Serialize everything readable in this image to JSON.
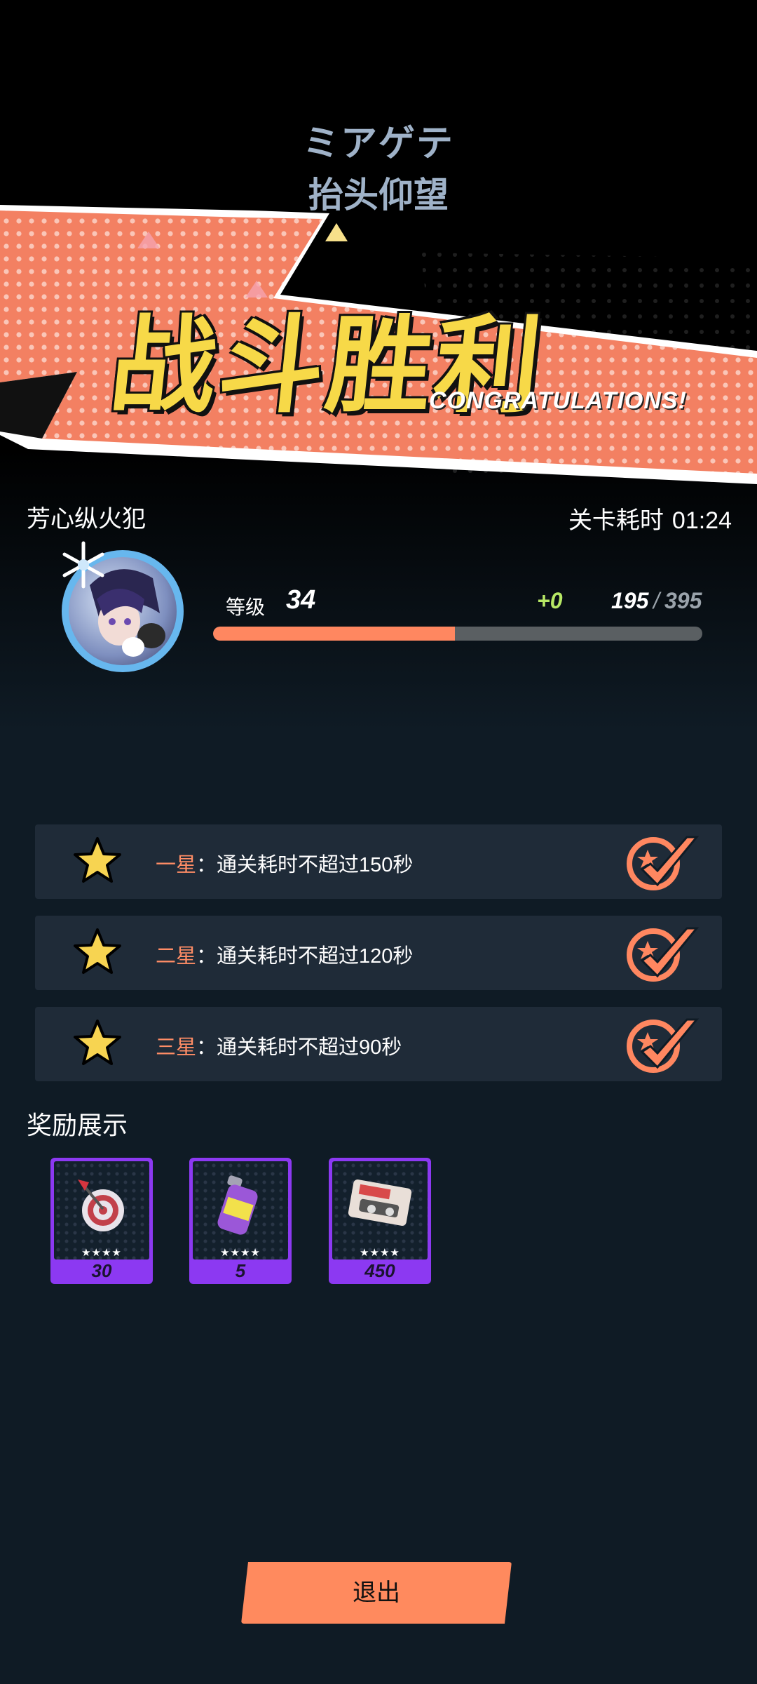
{
  "song": {
    "title_jp": "ミアゲテ",
    "title_cn": "抬头仰望"
  },
  "banner": {
    "title": "战斗胜利",
    "subtitle": "CONGRATULATIONS!"
  },
  "character": {
    "name": "芳心纵火犯"
  },
  "stage": {
    "time_label": "关卡耗时",
    "time_value": "01:24"
  },
  "level": {
    "label": "等级",
    "value": "34",
    "exp_gain": "+0",
    "exp_current": "195",
    "exp_slash": "/",
    "exp_max": "395",
    "exp_progress": 0.4936
  },
  "stars": [
    {
      "label": "一星",
      "sep": "：",
      "condition": "通关耗时不超过150秒",
      "icon": "star-icon",
      "status_icon": "check-icon"
    },
    {
      "label": "二星",
      "sep": "：",
      "condition": "通关耗时不超过120秒",
      "icon": "star-icon",
      "status_icon": "check-icon"
    },
    {
      "label": "三星",
      "sep": "：",
      "condition": "通关耗时不超过90秒",
      "icon": "star-icon",
      "status_icon": "check-icon"
    }
  ],
  "rewards": {
    "title": "奖励展示",
    "items": [
      {
        "icon": "dart-target-icon",
        "stars": "★★★★",
        "qty": "30"
      },
      {
        "icon": "spray-can-icon",
        "stars": "★★★★",
        "qty": "5"
      },
      {
        "icon": "cassette-tape-icon",
        "stars": "★★★★",
        "qty": "450"
      }
    ]
  },
  "exit_button": {
    "label": "退出"
  },
  "colors": {
    "accent": "#ff8760",
    "title_yellow": "#f7d948",
    "card_purple": "#8c39f2",
    "exp_green": "#b7e865",
    "background": "#0f1b25"
  }
}
